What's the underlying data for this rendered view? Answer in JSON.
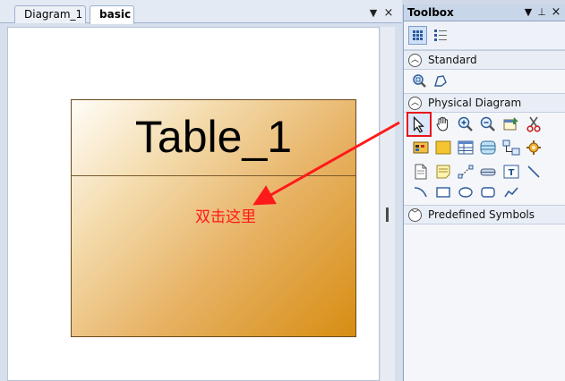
{
  "document": {
    "tabs": [
      {
        "label": "Diagram_1",
        "active": false
      },
      {
        "label": "basic",
        "active": true
      }
    ],
    "menu_glyph": "▼",
    "close_glyph": "×"
  },
  "canvas": {
    "entity": {
      "title": "Table_1"
    },
    "annotation": {
      "text": "双击这里",
      "color": "#ff1a1a"
    }
  },
  "toolbox": {
    "title": "Toolbox",
    "menu_glyph": "▼",
    "pin_glyph": "⊥",
    "close_glyph": "×",
    "view_buttons": [
      "icon-view-icon",
      "list-view-icon"
    ],
    "sections": [
      {
        "label": "Standard",
        "expanded": true,
        "tools": [
          "zoom-fit-icon",
          "lasso-icon"
        ]
      },
      {
        "label": "Physical Diagram",
        "expanded": true,
        "tools": [
          "pointer-icon",
          "hand-icon",
          "zoom-in-icon",
          "zoom-out-icon",
          "properties-icon",
          "cut-icon",
          "package-icon",
          "area-icon",
          "table-icon",
          "view-icon",
          "reference-icon",
          "procedure-icon",
          "file-icon",
          "note-icon",
          "link-icon",
          "database-icon",
          "text-icon",
          "line-icon",
          "arc-icon",
          "rectangle-icon",
          "ellipse-icon",
          "rounded-rectangle-icon",
          "polyline-icon"
        ]
      },
      {
        "label": "Predefined Symbols",
        "expanded": false,
        "tools": []
      }
    ],
    "highlighted_tool": "pointer-icon",
    "highlight_color": "#e8141b"
  }
}
